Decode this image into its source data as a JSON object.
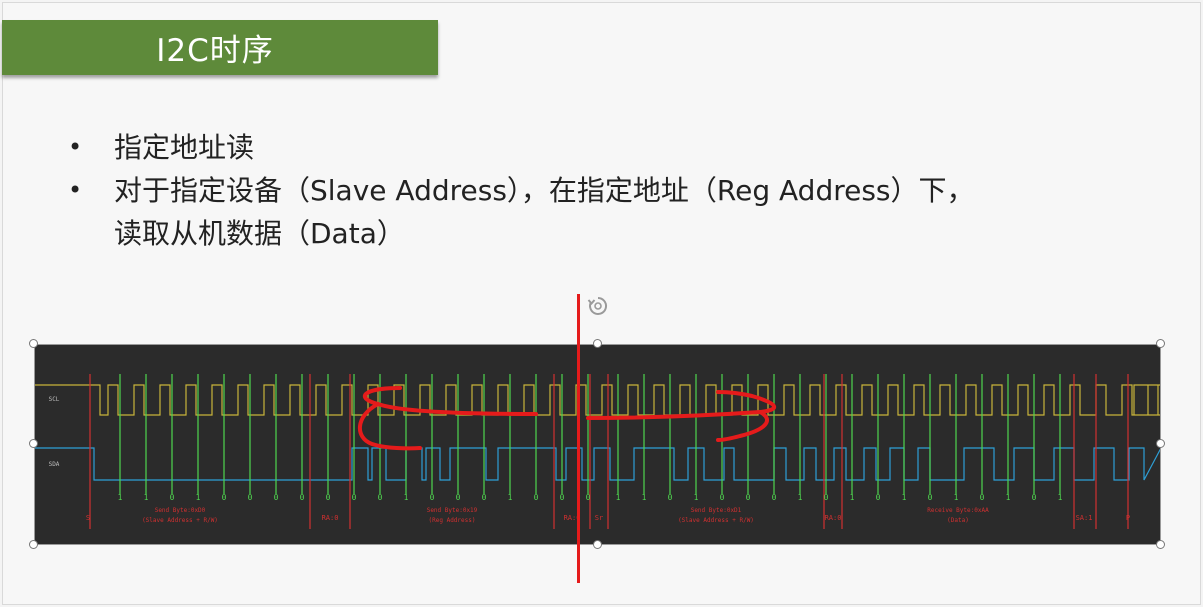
{
  "slide": {
    "title": "I2C时序",
    "bullets": [
      {
        "text": "指定地址读"
      },
      {
        "text": "对于指定设备（Slave Address），在指定地址（Reg Address）下，",
        "continuation": "读取从机数据（Data）"
      }
    ]
  },
  "timing_diagram": {
    "scl_label": "SCL",
    "sda_label": "SDA",
    "bits": [
      "1",
      "1",
      "0",
      "1",
      "0",
      "0",
      "0",
      "0",
      "0",
      "0",
      "0",
      "1",
      "0",
      "0",
      "0",
      "1",
      "0",
      "0",
      "0",
      "1",
      "1",
      "0",
      "1",
      "0",
      "0",
      "0",
      "1",
      "0",
      "1",
      "0",
      "1",
      "0",
      "1",
      "0",
      "1",
      "0",
      "1"
    ],
    "segments": [
      {
        "label": "S"
      },
      {
        "label": "Send Byte:0xD0",
        "sub": "(Slave Address + R/W)"
      },
      {
        "label": "RA:0"
      },
      {
        "label": "Send Byte:0x19",
        "sub": "(Reg Address)"
      },
      {
        "label": "RA:0"
      },
      {
        "label": "Sr"
      },
      {
        "label": "Send Byte:0xD1",
        "sub": "(Slave Address + R/W)"
      },
      {
        "label": "RA:0"
      },
      {
        "label": "Receive Byte:0xAA",
        "sub": "(Data)"
      },
      {
        "label": "SA:1"
      },
      {
        "label": "P"
      }
    ],
    "colors": {
      "scl": "#c8b43a",
      "sda": "#2e9fd6",
      "bit_marker": "#4fd64f",
      "segment_marker": "#d03030",
      "annotation": "#e51b1b"
    }
  }
}
